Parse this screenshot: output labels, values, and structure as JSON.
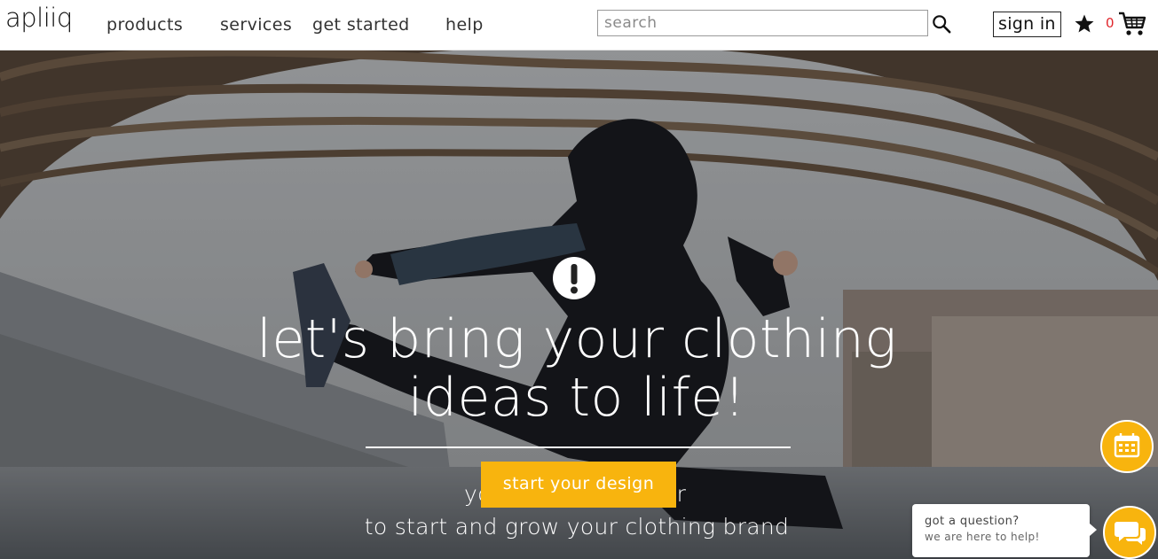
{
  "header": {
    "logo_text": "apliiq",
    "nav": [
      "products",
      "services",
      "get started",
      "help"
    ],
    "search_placeholder": "search",
    "signin_label": "sign in",
    "cart_count": "0"
  },
  "hero": {
    "headline_line1": "let's bring your clothing",
    "headline_line2": "ideas to life!",
    "subline1_left": "yo",
    "subline1_right": "er",
    "subline2": "to start and grow your clothing brand",
    "cta_label": "start your design"
  },
  "chat": {
    "title": "got a question?",
    "subtitle": "we are here to help!"
  },
  "colors": {
    "accent": "#f8b40e",
    "cart_count": "#e0252b"
  },
  "icons": [
    "search-icon",
    "star-icon",
    "cart-icon",
    "alert-icon",
    "calendar-icon",
    "chat-icon"
  ]
}
